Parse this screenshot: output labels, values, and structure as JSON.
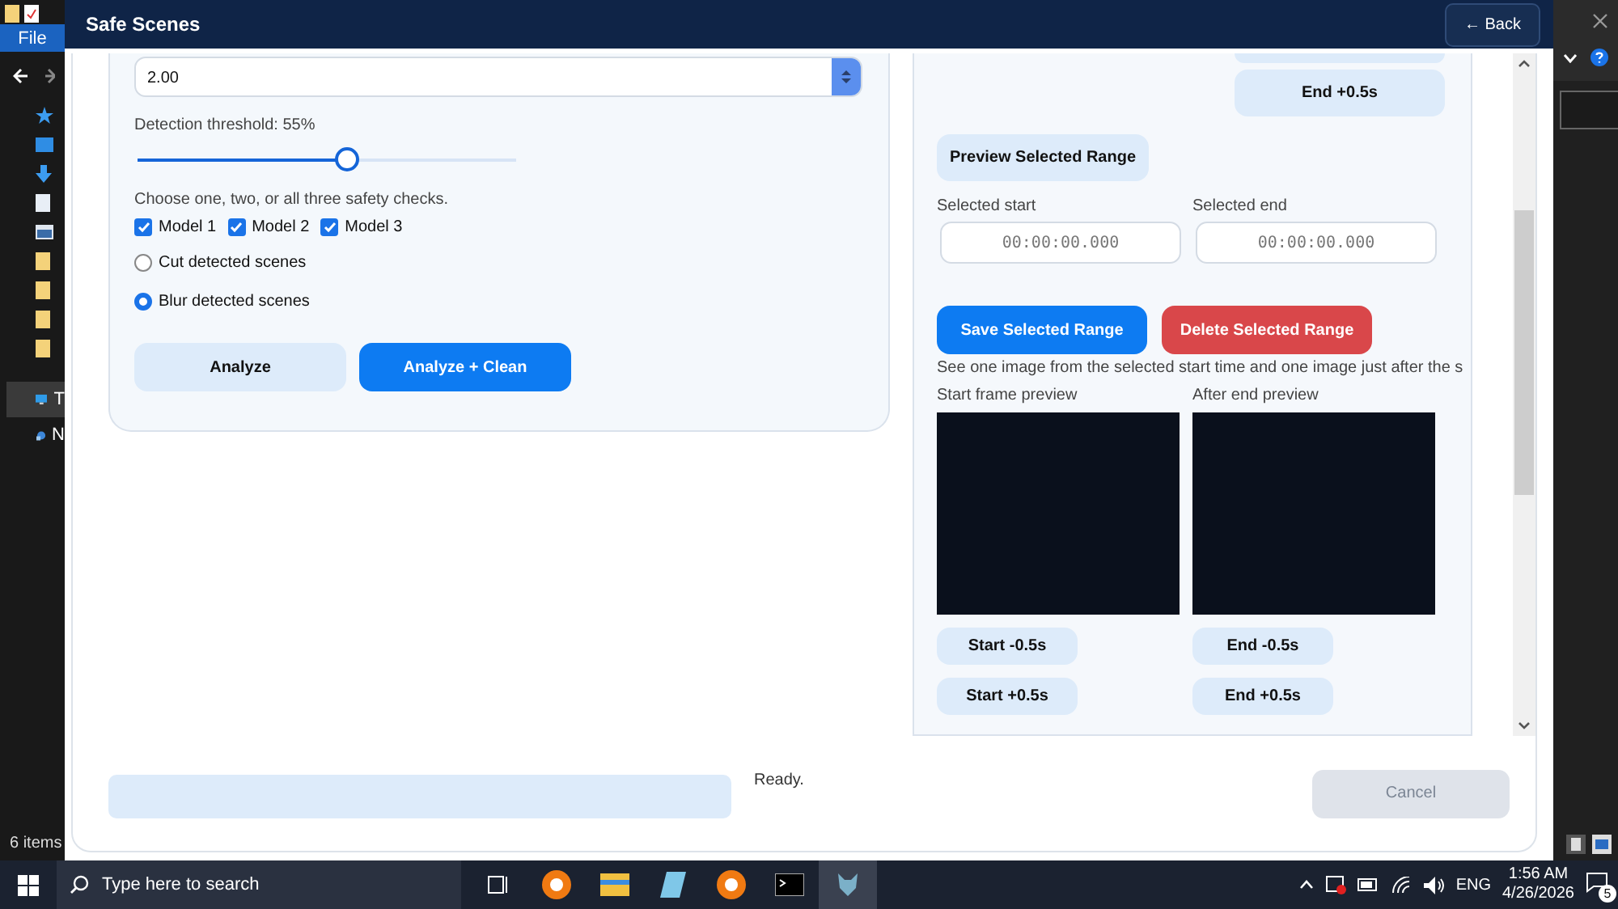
{
  "explorer": {
    "menu": "File",
    "nav_items": [
      {
        "label": "T",
        "selected": true
      },
      {
        "label": "N",
        "selected": false
      }
    ],
    "status": "6 items"
  },
  "window": {
    "title": "Safe Scenes",
    "back_button": "← Back"
  },
  "settings": {
    "number_value": "2.00",
    "threshold_label": "Detection threshold: 55%",
    "threshold": {
      "level": 0.55
    },
    "models_hint": "Choose one, two, or all three safety checks.",
    "models": [
      {
        "label": "Model 1",
        "checked": true
      },
      {
        "label": "Model 2",
        "checked": true
      },
      {
        "label": "Model 3",
        "checked": true
      }
    ],
    "modes": [
      {
        "label": "Cut detected scenes",
        "selected": false
      },
      {
        "label": "Blur detected scenes",
        "selected": true
      }
    ],
    "buttons": [
      {
        "label": "Analyze",
        "kind": "secondary"
      },
      {
        "label": "Analyze + Clean",
        "kind": "primary"
      }
    ]
  },
  "range_panel": {
    "top_button": "End +0.5s",
    "preview_button": "Preview Selected Range",
    "fields": [
      {
        "label": "Selected start",
        "placeholder": "00:00:00.000"
      },
      {
        "label": "Selected end",
        "placeholder": "00:00:00.000"
      }
    ],
    "actions": [
      {
        "label": "Save Selected Range",
        "kind": "primary"
      },
      {
        "label": "Delete Selected Range",
        "kind": "danger"
      }
    ],
    "hint": "See one image from the selected start time and one image just after the s",
    "previews": [
      {
        "label": "Start frame preview",
        "buttons": [
          "Start -0.5s",
          "Start +0.5s"
        ]
      },
      {
        "label": "After end preview",
        "buttons": [
          "End -0.5s",
          "End +0.5s"
        ]
      }
    ]
  },
  "footer": {
    "progress": {
      "level": 0
    },
    "status": "Ready.",
    "cancel": {
      "label": "Cancel",
      "disabled": true
    }
  },
  "taskbar": {
    "search_placeholder": "Type here to search",
    "language": "ENG",
    "time": "1:56 AM",
    "date": "4/26/2026",
    "notifications": "5"
  }
}
